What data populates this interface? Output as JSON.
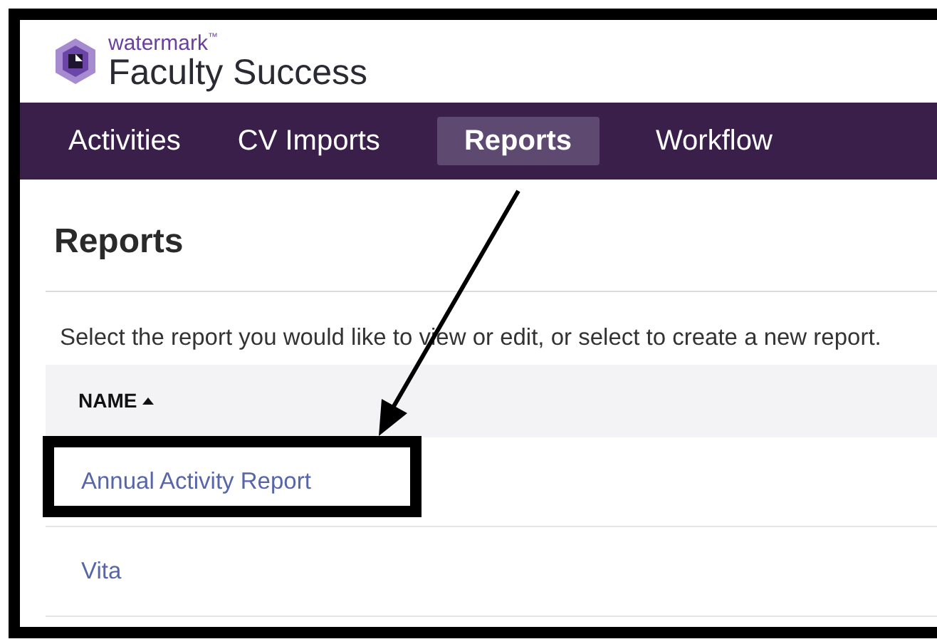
{
  "logo": {
    "brand": "watermark",
    "trademark": "™",
    "product": "Faculty Success"
  },
  "nav": [
    {
      "label": "Activities",
      "selected": false
    },
    {
      "label": "CV Imports",
      "selected": false
    },
    {
      "label": "Reports",
      "selected": true
    },
    {
      "label": "Workflow",
      "selected": false
    }
  ],
  "page_title": "Reports",
  "instructions": "Select the report you would like to view or edit, or select to create a new report.",
  "table": {
    "columns": [
      {
        "label": "NAME",
        "sorted_ascending": true
      }
    ],
    "rows": [
      {
        "name": "Annual Activity Report"
      },
      {
        "name": "Vita"
      }
    ]
  }
}
